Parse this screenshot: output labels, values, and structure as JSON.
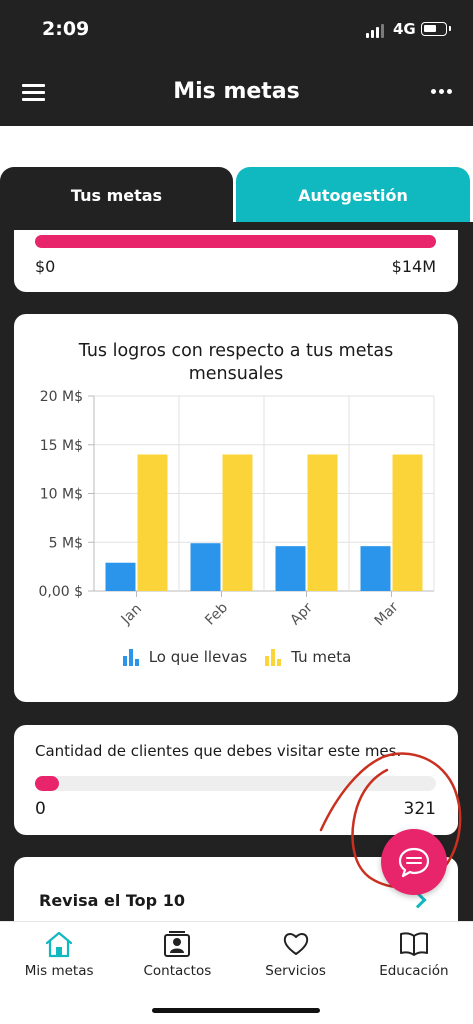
{
  "status_bar": {
    "time": "2:09",
    "network": "4G"
  },
  "app_bar": {
    "title": "Mis metas",
    "menu_icon": "hamburger-menu-icon",
    "more_icon": "more-dots-icon"
  },
  "tabs": [
    {
      "label": "Tus metas",
      "selected": true
    },
    {
      "label": "Autogestión",
      "selected": false
    }
  ],
  "goal_progress": {
    "min_label": "$0",
    "max_label": "$14M",
    "progress_fraction": 1.0
  },
  "chart_data": {
    "type": "bar",
    "title": "Tus logros con respecto a tus metas mensuales",
    "categories": [
      "Jan",
      "Feb",
      "Apr",
      "Mar"
    ],
    "series": [
      {
        "name": "Lo que llevas",
        "color": "#2b95eb",
        "values": [
          2.9,
          4.9,
          4.6,
          4.6
        ]
      },
      {
        "name": "Tu meta",
        "color": "#fbd43a",
        "values": [
          14,
          14,
          14,
          14
        ]
      }
    ],
    "y_ticks": [
      "0,00 $",
      "5 M$",
      "10 M$",
      "15 M$",
      "20 M$"
    ],
    "ylim": [
      0,
      20
    ],
    "grid": true
  },
  "visits": {
    "title": "Cantidad de clientes que debes visitar este mes.",
    "min_label": "0",
    "max_label": "321",
    "progress_fraction": 0.06
  },
  "top10": {
    "title": "Revisa el Top 10"
  },
  "fab": {
    "icon": "chat-bubble-icon"
  },
  "bottom_nav": [
    {
      "label": "Mis metas",
      "icon": "home-icon",
      "active": true
    },
    {
      "label": "Contactos",
      "icon": "contacts-icon",
      "active": false
    },
    {
      "label": "Servicios",
      "icon": "heart-icon",
      "active": false
    },
    {
      "label": "Educación",
      "icon": "book-icon",
      "active": false
    }
  ],
  "colors": {
    "accent_pink": "#e8246a",
    "accent_teal": "#10b8c0",
    "dark": "#222222",
    "annotation_red": "#c9301f"
  }
}
